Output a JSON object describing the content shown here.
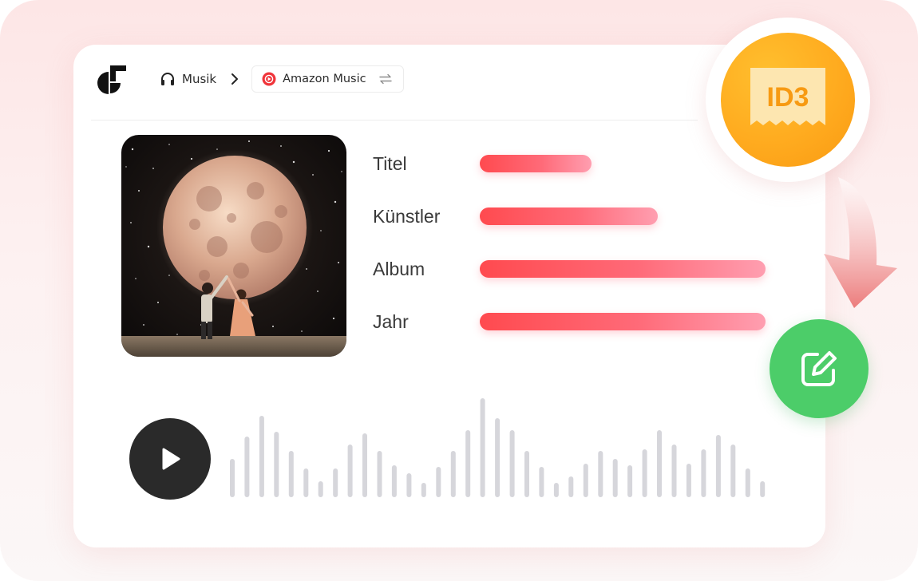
{
  "breadcrumb": {
    "home_icon": "headphones-icon",
    "home_label": "Musik",
    "separator_icon": "chevron-right-icon",
    "service_icon": "amazon-music-icon",
    "service_label": "Amazon Music",
    "switch_icon": "swap-arrows-icon"
  },
  "metadata_fields": [
    {
      "label": "Titel"
    },
    {
      "label": "Künstler"
    },
    {
      "label": "Album"
    },
    {
      "label": "Jahr"
    }
  ],
  "badge": {
    "text": "ID3",
    "icon": "id3-tag-icon"
  },
  "player": {
    "play_icon": "play-icon"
  },
  "edit": {
    "icon": "edit-icon"
  },
  "colors": {
    "accent_red": "#ff4a4f",
    "badge_orange": "#ffab1f",
    "edit_green": "#4ccd69",
    "player_dark": "#2a2a2a",
    "waveform_gray": "#d6d6db"
  }
}
